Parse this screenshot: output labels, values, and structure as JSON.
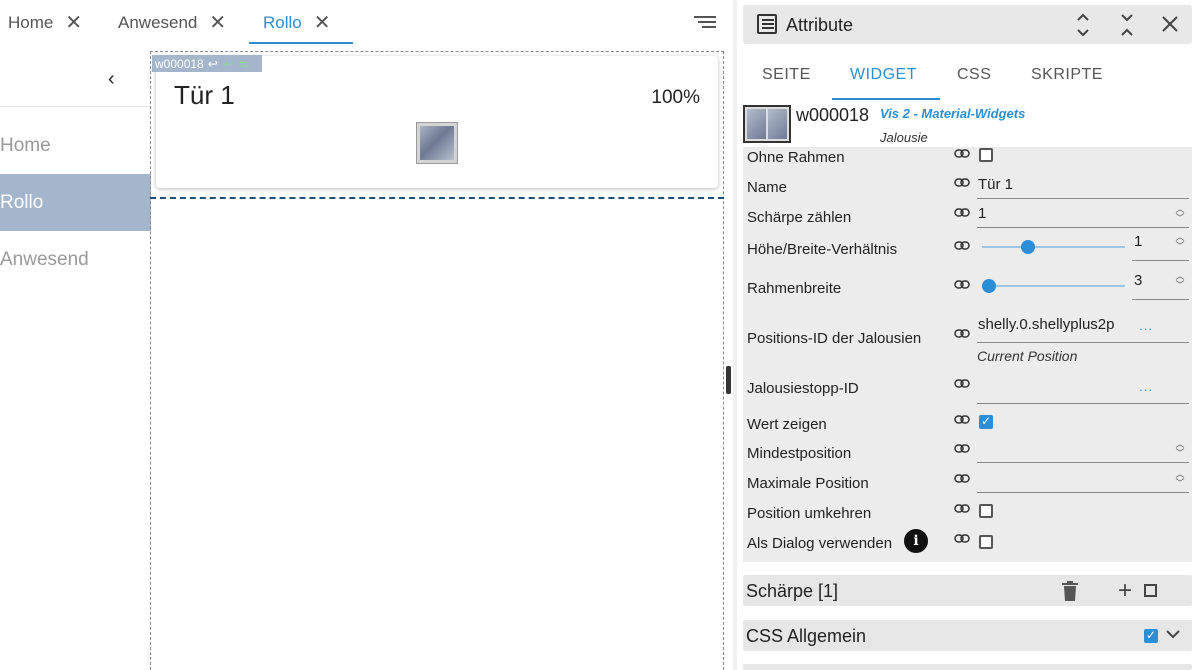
{
  "tabs": [
    {
      "label": "Home",
      "close": "✕"
    },
    {
      "label": "Anwesend",
      "close": "✕"
    },
    {
      "label": "Rollo",
      "close": "✕"
    }
  ],
  "sidebar": {
    "back": "‹",
    "items": [
      {
        "label": "Home"
      },
      {
        "label": "Rollo"
      },
      {
        "label": "Anwesend"
      }
    ]
  },
  "canvas": {
    "widget_label": "w000018",
    "widget_label_extra": "↩",
    "widget_label_green": "↩ ⇆",
    "widget_title": "Tür 1",
    "widget_value": "100%"
  },
  "panel": {
    "title": "Attribute",
    "tabs": [
      "SEITE",
      "WIDGET",
      "CSS",
      "SKRIPTE"
    ],
    "widget_id": "w000018",
    "widget_set": "Vis 2 - Material-Widgets",
    "widget_type": "Jalousie",
    "attrs": {
      "ohne_rahmen": "Ohne Rahmen",
      "name_label": "Name",
      "name_value": "Tür 1",
      "schaerpe_label": "Schärpe zählen",
      "schaerpe_value": "1",
      "ratio_label": "Höhe/Breite-Verhältnis",
      "ratio_value": "1",
      "rahmen_label": "Rahmenbreite",
      "rahmen_value": "3",
      "pos_id_label": "Positions-ID der Jalousien",
      "pos_id_value": "shelly.0.shellyplus2p",
      "pos_id_sub": "Current Position",
      "stop_id_label": "Jalousiestopp-ID",
      "wert_label": "Wert zeigen",
      "min_label": "Mindestposition",
      "max_label": "Maximale Position",
      "umkehren_label": "Position umkehren",
      "dialog_label": "Als Dialog verwenden",
      "dots": "..."
    },
    "section_schaerpe": "Schärpe [1]",
    "section_css": "CSS Allgemein"
  },
  "colors": {
    "accent": "#2b8ed6",
    "nav_active": "#a4b5cc"
  },
  "slider_levels": {
    "ratio_fraction": 0.3,
    "rahmen_fraction": 0.0
  }
}
